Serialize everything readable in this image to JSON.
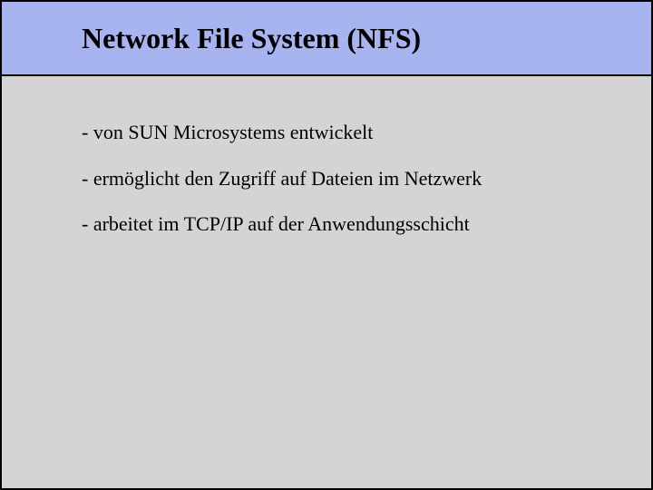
{
  "title": "Network File System (NFS)",
  "bullets": [
    "- von SUN Microsystems entwickelt",
    "- ermöglicht den Zugriff auf Dateien im Netzwerk",
    "- arbeitet im TCP/IP auf der Anwendungsschicht"
  ]
}
